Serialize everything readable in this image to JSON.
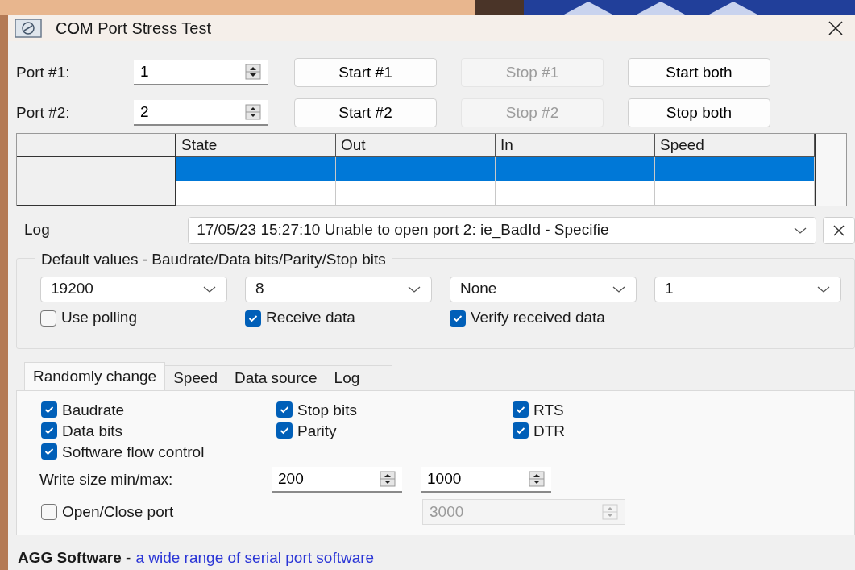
{
  "window": {
    "title": "COM Port Stress Test"
  },
  "ports": [
    {
      "label": "Port #1:",
      "value": "1",
      "buttons": [
        {
          "label": "Start #1",
          "disabled": false
        },
        {
          "label": "Stop #1",
          "disabled": true
        },
        {
          "label": "Start both",
          "disabled": false
        }
      ]
    },
    {
      "label": "Port #2:",
      "value": "2",
      "buttons": [
        {
          "label": "Start #2",
          "disabled": false
        },
        {
          "label": "Stop #2",
          "disabled": true
        },
        {
          "label": "Stop both",
          "disabled": false
        }
      ]
    }
  ],
  "grid": {
    "columns": [
      "State",
      "Out",
      "In",
      "Speed"
    ],
    "rows": [
      {
        "selected": true
      },
      {
        "selected": false
      }
    ]
  },
  "log": {
    "label": "Log",
    "value": "17/05/23 15:27:10 Unable to open port 2: ie_BadId - Specifie"
  },
  "defaults": {
    "title": "Default values - Baudrate/Data bits/Parity/Stop bits",
    "selects": [
      "19200",
      "8",
      "None",
      "1"
    ],
    "checkboxes": [
      {
        "label": "Use polling",
        "checked": false
      },
      {
        "label": "Receive data",
        "checked": true
      },
      {
        "label": "Verify received data",
        "checked": true
      }
    ]
  },
  "tabs": [
    {
      "label": "Randomly change",
      "selected": true
    },
    {
      "label": "Speed",
      "selected": false
    },
    {
      "label": "Data source",
      "selected": false
    },
    {
      "label": "Log",
      "selected": false
    }
  ],
  "randomly_change": {
    "checkboxes": [
      {
        "label": "Baudrate",
        "checked": true
      },
      {
        "label": "Stop bits",
        "checked": true
      },
      {
        "label": "RTS",
        "checked": true
      },
      {
        "label": "Data bits",
        "checked": true
      },
      {
        "label": "Parity",
        "checked": true
      },
      {
        "label": "DTR",
        "checked": true
      },
      {
        "label": "Software flow control",
        "checked": true
      }
    ],
    "write_size": {
      "label": "Write size min/max:",
      "min": "200",
      "max": "1000"
    },
    "open_close": {
      "label": "Open/Close port",
      "checked": false
    },
    "interval": {
      "value": "3000",
      "disabled": true
    }
  },
  "footer": {
    "text": "**AGG Software** -",
    "link": "a wide range of serial port software"
  }
}
